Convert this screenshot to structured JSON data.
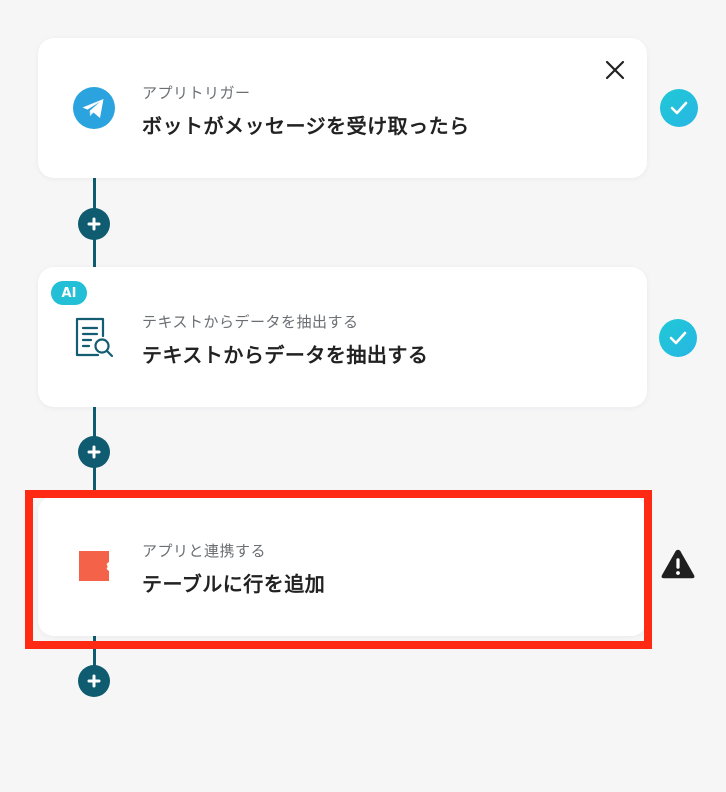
{
  "steps": [
    {
      "subtitle": "アプリトリガー",
      "title": "ボットがメッセージを受け取ったら",
      "icon": "telegram-icon",
      "status": "complete",
      "has_close_button": true
    },
    {
      "badge": "AI",
      "subtitle": "テキストからデータを抽出する",
      "title": "テキストからデータを抽出する",
      "icon": "document-search-icon",
      "status": "complete"
    },
    {
      "subtitle": "アプリと連携する",
      "title": "テーブルに行を追加",
      "icon": "app-logo-icon",
      "status": "warning",
      "highlighted": true
    }
  ],
  "colors": {
    "connector": "#0f5b70",
    "check": "#22c3dc",
    "highlight_border": "#ff2a14",
    "ai_badge": "#22bfd6",
    "app_logo": "#f4624a",
    "telegram": "#2aa3df"
  }
}
